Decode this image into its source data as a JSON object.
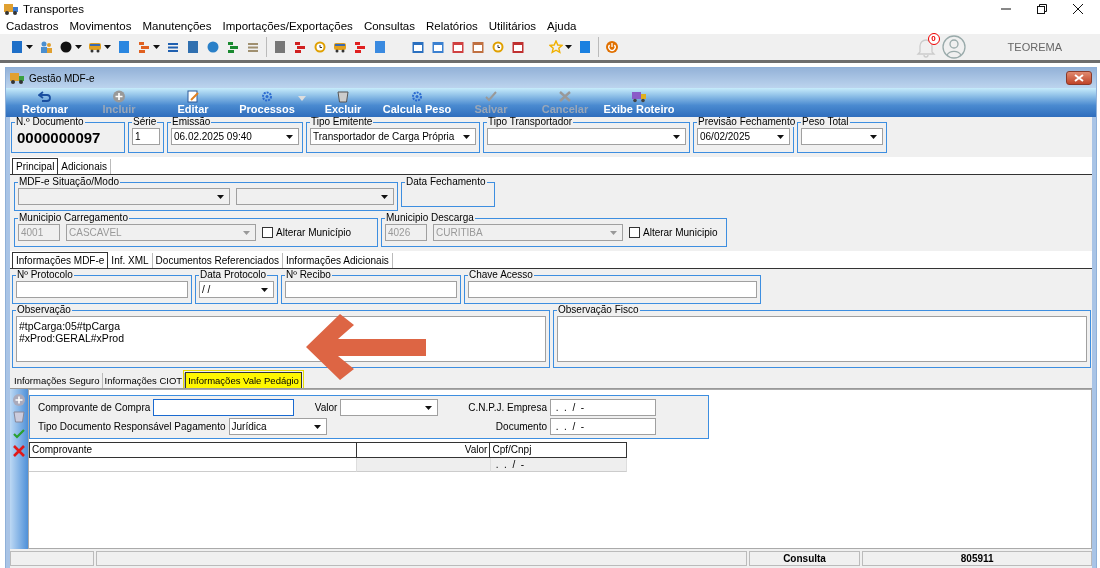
{
  "app": {
    "title": "Transportes"
  },
  "menu": [
    "Cadastros",
    "Movimentos",
    "Manutenções",
    "Importações/Exportações",
    "Consultas",
    "Relatórios",
    "Utilitários",
    "Ajuda"
  ],
  "notifications": {
    "count": "0"
  },
  "user": "TEOREMA",
  "window": {
    "title": "Gestão MDF-e"
  },
  "actions": [
    {
      "label": "Retornar",
      "disabled": false,
      "kind": "back"
    },
    {
      "label": "Incluir",
      "disabled": true,
      "kind": "add"
    },
    {
      "label": "Editar",
      "disabled": false,
      "kind": "edit"
    },
    {
      "label": "Processos",
      "disabled": false,
      "kind": "gear-menu"
    },
    {
      "label": "Excluir",
      "disabled": false,
      "kind": "trash"
    },
    {
      "label": "Calcula Peso",
      "disabled": false,
      "kind": "gear"
    },
    {
      "label": "Salvar",
      "disabled": true,
      "kind": "check"
    },
    {
      "label": "Cancelar",
      "disabled": true,
      "kind": "cancel"
    },
    {
      "label": "Exibe Roteiro",
      "disabled": false,
      "kind": "truck"
    }
  ],
  "header": [
    {
      "label": "N.º Documento",
      "kind": "number",
      "value": "0000000097"
    },
    {
      "label": "Série",
      "kind": "text",
      "value": "1"
    },
    {
      "label": "Emissão",
      "kind": "select",
      "value": "06.02.2025 09:40"
    },
    {
      "label": "Tipo Emitente",
      "kind": "select",
      "value": "Transportador de Carga Própria"
    },
    {
      "label": "Tipo Transportador",
      "kind": "select"
    },
    {
      "label": "Previsão Fechamento",
      "kind": "select",
      "value": "06/02/2025"
    },
    {
      "label": "Peso Total",
      "kind": "select"
    }
  ],
  "main_tabs": [
    {
      "label": "Principal",
      "selected": true
    },
    {
      "label": "Adicionais",
      "selected": false
    }
  ],
  "situacao": {
    "label": "MDF-e Situação/Modo"
  },
  "data_fechamento": {
    "label": "Data Fechamento"
  },
  "municipios": [
    {
      "label": "Municipio Carregamento",
      "code": "4001",
      "city": "CASCAVEL",
      "option": {
        "label": "Alterar Município",
        "checked": false
      }
    },
    {
      "label": "Municipio Descarga",
      "code": "4026",
      "city": "CURITIBA",
      "option": {
        "label": "Alterar Municipio",
        "checked": false
      }
    }
  ],
  "info_tabs": [
    {
      "label": "Informações MDF-e",
      "selected": true
    },
    {
      "label": "Inf. XML",
      "selected": false
    },
    {
      "label": "Documentos Referenciados",
      "selected": false
    },
    {
      "label": "Informações Adicionais",
      "selected": false
    }
  ],
  "info_fields": [
    {
      "label": "Nº Protocolo",
      "kind": "text"
    },
    {
      "label": "Data Protocolo",
      "kind": "select",
      "value": " / /"
    },
    {
      "label": "Nº Recibo",
      "kind": "text"
    },
    {
      "label": "Chave Acesso",
      "kind": "text"
    }
  ],
  "observacao": {
    "label": "Observação",
    "lines": [
      "#tpCarga:05#tpCarga",
      "#xProd:GERAL#xProd"
    ]
  },
  "observacao_fisco": {
    "label": "Observação Fisco"
  },
  "sub_tabs": [
    {
      "label": "Informações Seguro",
      "selected": false,
      "highlighted": false
    },
    {
      "label": "Informações CIOT",
      "selected": false,
      "highlighted": false
    },
    {
      "label": "Informações Vale Pedágio",
      "selected": true,
      "highlighted": true
    }
  ],
  "side_tools": [
    {
      "kind": "add",
      "disabled": true
    },
    {
      "kind": "trash",
      "disabled": true
    },
    {
      "kind": "check",
      "disabled": false
    },
    {
      "kind": "cancel",
      "disabled": false
    }
  ],
  "vale": {
    "comprovante": {
      "label": "Comprovante de Compra"
    },
    "valor": {
      "label": "Valor"
    },
    "cnpj": {
      "label": "C.N.P.J. Empresa",
      "value": " .  .  /  -"
    },
    "tipo_documento": {
      "label": "Tipo Documento Responsável Pagamento",
      "value": "Jurídica"
    },
    "documento": {
      "label": "Documento",
      "value": " .  .  /  -"
    }
  },
  "grid": {
    "columns": [
      "Comprovante",
      "Valor",
      "Cpf/Cnpj"
    ],
    "rows": [
      {
        "cpf_cnpj": " .  .  /  -"
      }
    ]
  },
  "status_bar": [
    "Consulta",
    "805911"
  ]
}
